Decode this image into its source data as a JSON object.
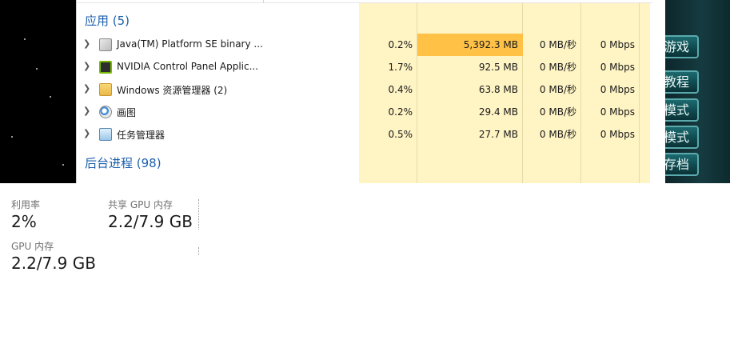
{
  "game_menu": {
    "items": [
      "游戏",
      "教程",
      "模式",
      "模式",
      "存档"
    ]
  },
  "task_manager": {
    "apps_header": "应用 (5)",
    "background_header": "后台进程 (98)",
    "apps": [
      {
        "name": "Java(TM) Platform SE binary ...",
        "cpu": "0.2%",
        "memory": "5,392.3 MB",
        "disk": "0 MB/秒",
        "network": "0 Mbps",
        "icon": "java-icon"
      },
      {
        "name": "NVIDIA Control Panel Applic...",
        "cpu": "1.7%",
        "memory": "92.5 MB",
        "disk": "0 MB/秒",
        "network": "0 Mbps",
        "icon": "nvidia-icon"
      },
      {
        "name": "Windows 资源管理器 (2)",
        "cpu": "0.4%",
        "memory": "63.8 MB",
        "disk": "0 MB/秒",
        "network": "0 Mbps",
        "icon": "folder-icon"
      },
      {
        "name": "画图",
        "cpu": "0.2%",
        "memory": "29.4 MB",
        "disk": "0 MB/秒",
        "network": "0 Mbps",
        "icon": "paint-icon"
      },
      {
        "name": "任务管理器",
        "cpu": "0.5%",
        "memory": "27.7 MB",
        "disk": "0 MB/秒",
        "network": "0 Mbps",
        "icon": "task-manager-icon"
      }
    ],
    "colors": {
      "group_header": "#1b5fad",
      "heat_light": "#fff4c4",
      "heat_high": "#ffc247"
    }
  },
  "gpu_stats": {
    "utilization_label": "利用率",
    "utilization_value": "2%",
    "shared_label": "共享 GPU 内存",
    "shared_value": "2.2/7.9 GB",
    "dedicated_label": "GPU 内存",
    "dedicated_value": "2.2/7.9 GB"
  }
}
